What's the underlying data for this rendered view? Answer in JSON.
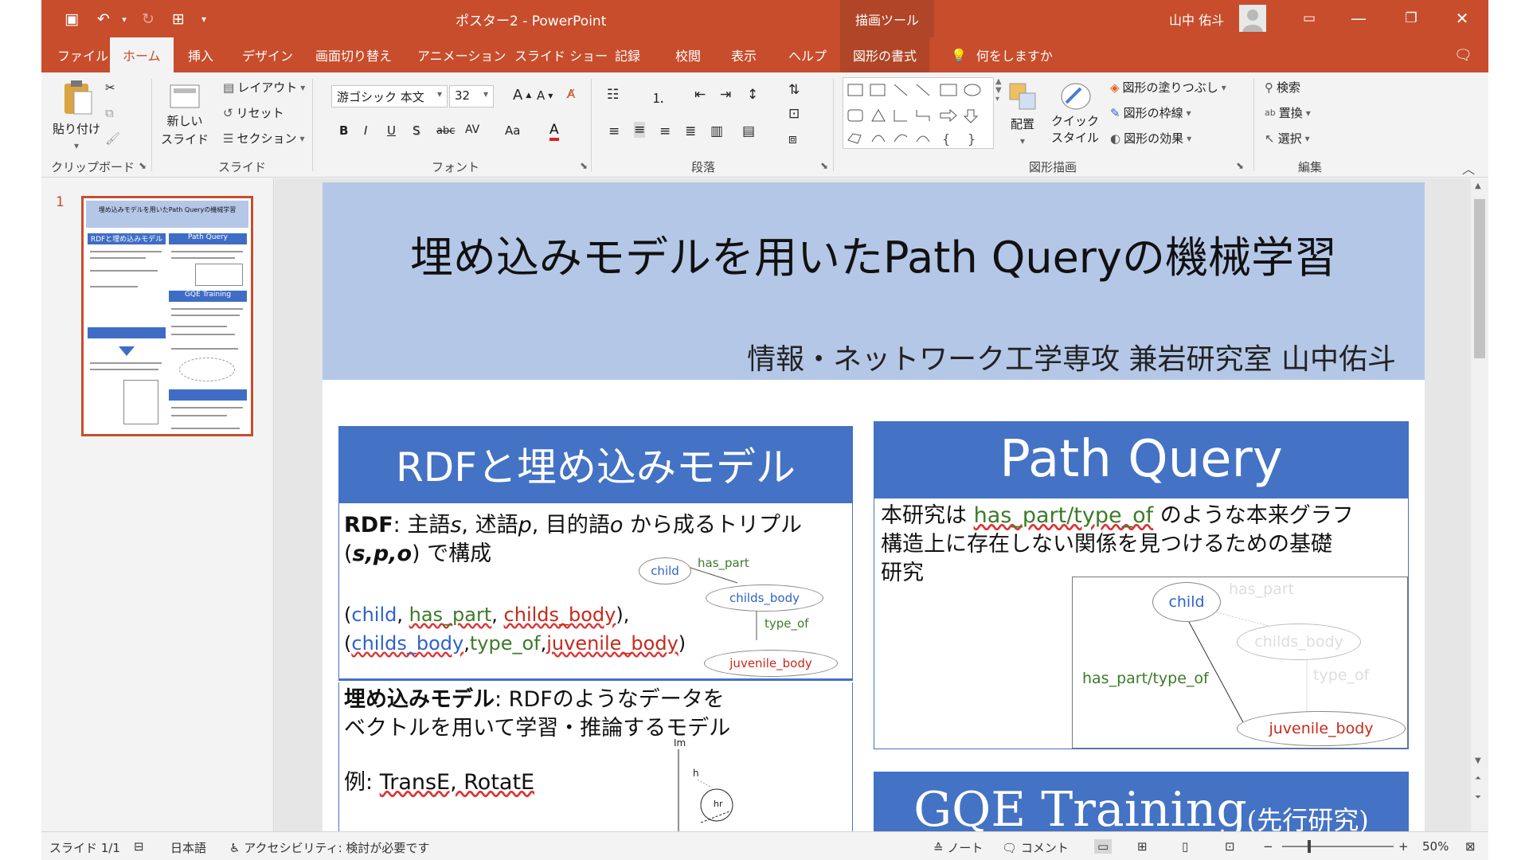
{
  "titlebar": {
    "doc_title": "ポスター2 - PowerPoint",
    "context_tab": "描画ツール",
    "user_name": "山中 佑斗"
  },
  "tabs": [
    "ファイル",
    "ホーム",
    "挿入",
    "デザイン",
    "画面切り替え",
    "アニメーション",
    "スライド ショー",
    "記録",
    "校閲",
    "表示",
    "ヘルプ",
    "図形の書式"
  ],
  "tell_me": "何をしますか",
  "ribbon": {
    "clipboard": {
      "paste": "貼り付け",
      "label": "クリップボード"
    },
    "slides": {
      "new_slide_1": "新しい",
      "new_slide_2": "スライド",
      "layout": "レイアウト",
      "reset": "リセット",
      "section": "セクション",
      "label": "スライド"
    },
    "font": {
      "name": "游ゴシック 本文",
      "size": "32",
      "label": "フォント",
      "bold": "B",
      "italic": "I",
      "underline": "U",
      "shadow": "S",
      "strike": "abc",
      "spacing": "AV",
      "case": "Aa",
      "color": "A"
    },
    "paragraph": {
      "label": "段落"
    },
    "drawing": {
      "arrange": "配置",
      "quick_style_1": "クイック",
      "quick_style_2": "スタイル",
      "fill": "図形の塗りつぶし",
      "outline": "図形の枠線",
      "effects": "図形の効果",
      "label": "図形描画"
    },
    "editing": {
      "find": "検索",
      "replace": "置換",
      "select": "選択",
      "label": "編集"
    }
  },
  "thumbnails": {
    "number": "1",
    "title": "埋め込みモデルを用いたPath Queryの機械学習"
  },
  "slide": {
    "title": "埋め込みモデルを用いたPath Queryの機械学習",
    "author": "情報・ネットワーク工学専攻 兼岩研究室 山中佑斗",
    "rdf": {
      "heading": "RDFと埋め込みモデル",
      "rdf_bold": "RDF",
      "rdf_text1": ": 主語",
      "s": "s",
      "rdf_text2": ", 述語",
      "p": "p",
      "rdf_text3": ", 目的語",
      "o": "o",
      "rdf_text4": " から成るトリプル",
      "spo_open": "(",
      "spo": "s,p,o",
      "spo_close": ") で構成",
      "t1_child": "child",
      "t1_has_part": "has_part",
      "t1_childs_body": "childs_body",
      "t2_childs_body": "childs_body",
      "t2_type_of": "type_of",
      "t2_juvenile": "juvenile_body",
      "embed_bold": "埋め込みモデル",
      "embed_text": ": RDFのようなデータを",
      "embed_text2": "ベクトルを用いて学習・推論するモデル",
      "example_prefix": "例: ",
      "example": "TransE, RotatE",
      "graph": {
        "child": "child",
        "has_part": "has_part",
        "childs_body": "childs_body",
        "type_of": "type_of",
        "juvenile_body": "juvenile_body"
      },
      "vec": {
        "im": "Im",
        "h": "h",
        "hr": "hr"
      }
    },
    "path_query": {
      "heading": "Path Query",
      "text1": "本研究は ",
      "link": "has_part/type_of",
      "text2": " のような本来グラフ",
      "text3": "構造上に存在しない関係を見つけるための基礎",
      "text4": "研究",
      "graph": {
        "child": "child",
        "has_part": "has_part",
        "childs_body": "childs_body",
        "type_of": "type_of",
        "path": "has_part/type_of",
        "juvenile_body": "juvenile_body"
      }
    },
    "goe": {
      "heading": "GQE Training",
      "sub": "(先行研究)"
    }
  },
  "status": {
    "slide": "スライド 1/1",
    "lang": "日本語",
    "accessibility": "アクセシビリティ: 検討が必要です",
    "notes": "ノート",
    "comments": "コメント",
    "zoom": "50%"
  }
}
